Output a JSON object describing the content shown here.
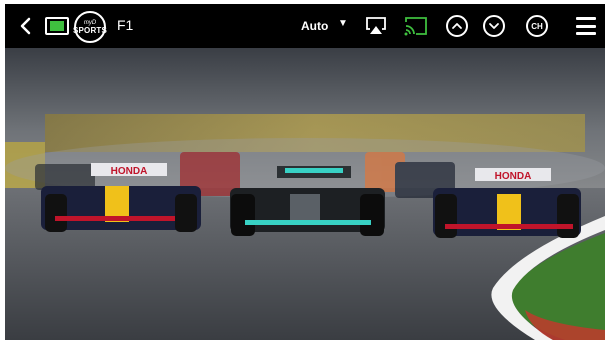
{
  "player": {
    "channel": "F1",
    "logo_top": "myD",
    "logo_main": "SPORTS",
    "quality": "Auto",
    "ch_label": "CH"
  },
  "video": {
    "car_livery_left": "HONDA",
    "car_livery_right": "HONDA"
  },
  "colors": {
    "bar_bg": "#000000",
    "tv_accent": "#3fbf3f",
    "cast_accent": "#3fbf3f"
  },
  "icons": [
    "back-icon",
    "tv-icon",
    "airplay-icon",
    "cast-icon",
    "chevron-up-icon",
    "chevron-down-icon",
    "menu-icon"
  ]
}
